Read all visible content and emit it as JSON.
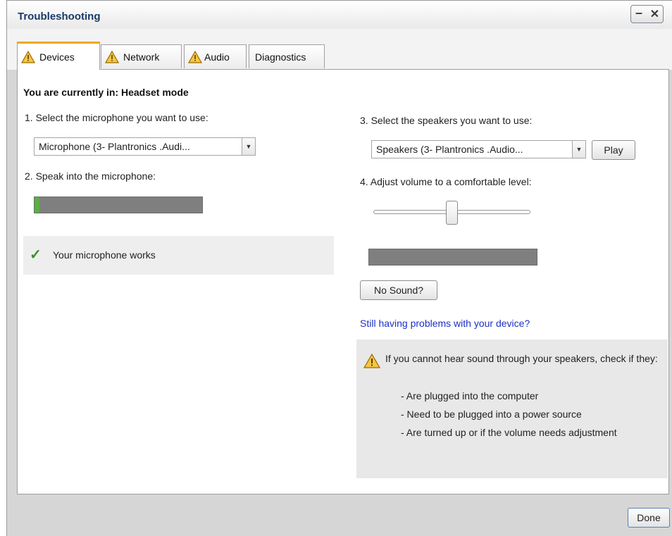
{
  "window": {
    "title": "Troubleshooting"
  },
  "tabs": [
    {
      "label": "Devices",
      "warning": true
    },
    {
      "label": "Network",
      "warning": true
    },
    {
      "label": "Audio",
      "warning": true
    },
    {
      "label": "Diagnostics",
      "warning": false
    }
  ],
  "active_tab": "Devices",
  "devices": {
    "mode_text": "You are currently in: Headset mode",
    "step1": "1. Select the microphone you want to use:",
    "microphone_value": "Microphone (3- Plantronics .Audi...",
    "step2": "2. Speak into the microphone:",
    "mic_level_percent": 3,
    "mic_status": "Your microphone works",
    "step3": "3. Select the speakers you want to use:",
    "speakers_value": "Speakers (3- Plantronics .Audio...",
    "play_label": "Play",
    "step4": "4. Adjust volume to a comfortable level:",
    "volume_percent": 50,
    "speaker_level_percent": 0,
    "no_sound_label": "No Sound?",
    "help_link": "Still having problems with your device?",
    "info": {
      "heading": "If you cannot hear sound through your speakers, check if they:",
      "items": [
        "- Are plugged into the computer",
        "- Need to be plugged into a power source",
        "- Are turned up or if the volume needs adjustment"
      ]
    }
  },
  "footer": {
    "done_label": "Done"
  },
  "colors": {
    "accent_tab": "#f0a722",
    "link": "#1d2fc3",
    "success": "#3a8e2a",
    "meter_fill": "#58b040"
  },
  "icons": {
    "warning": "warning-triangle-icon",
    "check": "checkmark-icon"
  }
}
